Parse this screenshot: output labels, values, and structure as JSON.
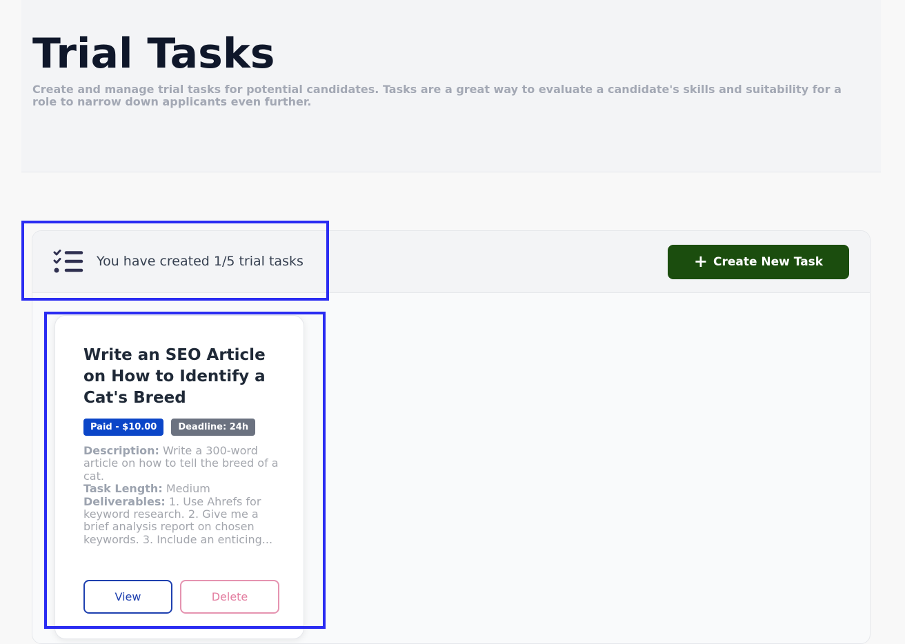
{
  "header": {
    "title": "Trial Tasks",
    "subtitle": "Create and manage trial tasks for potential candidates. Tasks are a great way to evaluate a candidate's skills and suitability for a role to narrow down applicants even further."
  },
  "panel": {
    "task_count_text": "You have created 1/5 trial tasks",
    "create_button_label": "Create New Task"
  },
  "task_card": {
    "title": "Write an SEO Article on How to Identify a Cat's Breed",
    "paid_badge": "Paid - $10.00",
    "deadline_badge": "Deadline: 24h",
    "description_label": "Description:",
    "description": "Write a 300-word article on how to tell the breed of a cat.",
    "length_label": "Task Length:",
    "length": "Medium",
    "deliverables_label": "Deliverables:",
    "deliverables": "1. Use Ahrefs for keyword research. 2. Give me a brief analysis report on chosen keywords. 3. Include an enticing...",
    "view_label": "View",
    "delete_label": "Delete"
  },
  "colors": {
    "primary_green": "#1b4d0e",
    "paid_badge": "#0b46c8",
    "deadline_badge": "#6b7280",
    "view_border": "#1e40af",
    "delete_border": "#e593b0",
    "highlight": "#2a2cf2"
  },
  "icons": {
    "task_list": "list-check-icon",
    "create": "plus-icon"
  }
}
